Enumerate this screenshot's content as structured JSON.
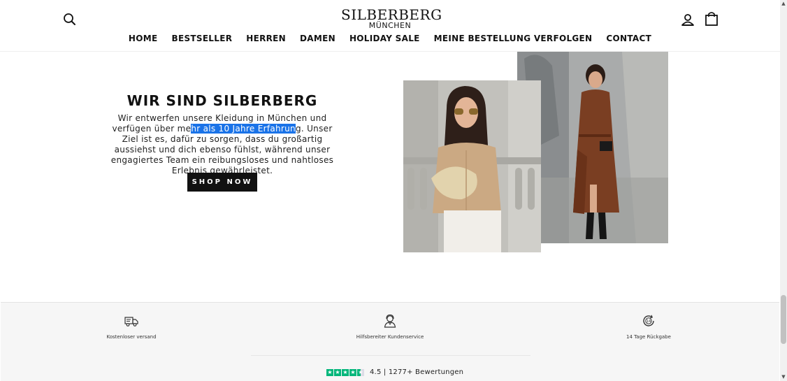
{
  "header": {
    "logo_main": "SILBERBERG",
    "logo_sub": "MÜNCHEN",
    "search_icon": "search-icon",
    "account_icon": "user-icon",
    "cart_icon": "shopping-bag-icon"
  },
  "nav": {
    "items": [
      "HOME",
      "BESTSELLER",
      "HERREN",
      "DAMEN",
      "HOLIDAY SALE",
      "MEINE BESTELLUNG VERFOLGEN",
      "CONTACT"
    ]
  },
  "hero": {
    "title": "WIR SIND SILBERBERG",
    "text_before": "Wir entwerfen unsere Kleidung in München und verfügen über me",
    "text_selected": "hr als 10 Jahre Erfahrun",
    "text_after": "g. Unser Ziel ist es, dafür zu sorgen, dass du großartig aussiehst und dich ebenso fühlst, während unser engagiertes Team ein reibungsloses und nahtloses Erlebnis gewährleistet.",
    "cta": "SHOP NOW"
  },
  "features": [
    {
      "icon": "delivery-truck-icon",
      "label": "Kostenloser versand"
    },
    {
      "icon": "support-agent-icon",
      "label": "Hilfsbereiter Kundenservice"
    },
    {
      "icon": "return-14-days-icon",
      "label": "14 Tage Rückgabe"
    }
  ],
  "rating": {
    "stars": 4.5,
    "text": "4.5 | 1277+ Bewertungen"
  },
  "colors": {
    "accent": "#111111",
    "selection": "#1a73e8",
    "trustpilot_green": "#00b67a"
  }
}
